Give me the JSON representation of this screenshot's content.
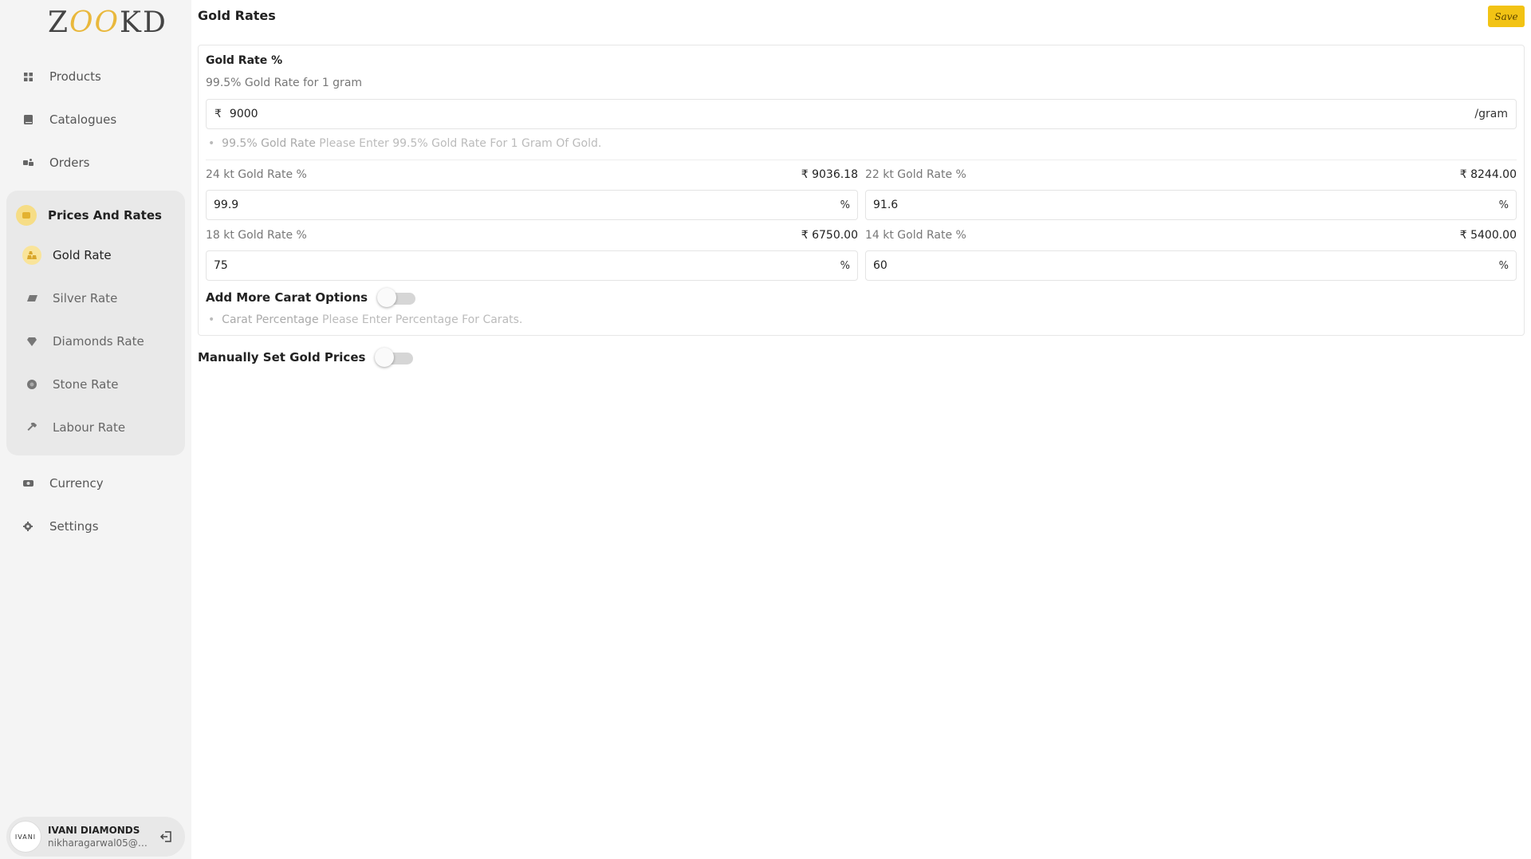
{
  "brand": {
    "logo_left": "Z",
    "logo_oo": "OO",
    "logo_right": "KD"
  },
  "sidebar": {
    "nav_top": [
      {
        "label": "Products",
        "icon": "grid-icon"
      },
      {
        "label": "Catalogues",
        "icon": "book-icon"
      },
      {
        "label": "Orders",
        "icon": "orders-icon"
      }
    ],
    "group": {
      "label": "Prices And Rates",
      "icon": "price-tag-icon",
      "items": [
        {
          "label": "Gold Rate",
          "icon": "gold-bars-icon",
          "active": true
        },
        {
          "label": "Silver Rate",
          "icon": "silver-bar-icon"
        },
        {
          "label": "Diamonds Rate",
          "icon": "diamond-icon"
        },
        {
          "label": "Stone Rate",
          "icon": "stone-icon"
        },
        {
          "label": "Labour Rate",
          "icon": "hammer-icon"
        }
      ]
    },
    "nav_bottom": [
      {
        "label": "Currency",
        "icon": "currency-icon"
      },
      {
        "label": "Settings",
        "icon": "gear-icon"
      }
    ],
    "user": {
      "avatar_text": "IVANI",
      "name": "IVANI DIAMONDS",
      "email": "nikharagarwal05@gmail.com"
    }
  },
  "header": {
    "title": "Gold Rates",
    "save_label": "Save"
  },
  "gold_card": {
    "title": "Gold Rate %",
    "base_label": "99.5% Gold Rate for 1 gram",
    "currency_symbol": "₹",
    "base_value": "9000",
    "base_unit": "/gram",
    "base_hint_bold": "99.5% Gold Rate",
    "base_hint_text": " Please Enter 99.5% Gold Rate For 1 Gram Of Gold.",
    "rates": [
      {
        "label": "24 kt Gold Rate %",
        "amount": "₹ 9036.18",
        "value": "99.9",
        "unit": "%"
      },
      {
        "label": "22 kt Gold Rate %",
        "amount": "₹ 8244.00",
        "value": "91.6",
        "unit": "%"
      },
      {
        "label": "18 kt Gold Rate %",
        "amount": "₹ 6750.00",
        "value": "75",
        "unit": "%"
      },
      {
        "label": "14 kt Gold Rate %",
        "amount": "₹ 5400.00",
        "value": "60",
        "unit": "%"
      }
    ],
    "carat_toggle_label": "Add More Carat Options",
    "carat_toggle_on": false,
    "carat_hint_bold": "Carat Percentage",
    "carat_hint_text": " Please Enter Percentage For Carats."
  },
  "manual": {
    "label": "Manually Set Gold Prices",
    "on": false
  }
}
